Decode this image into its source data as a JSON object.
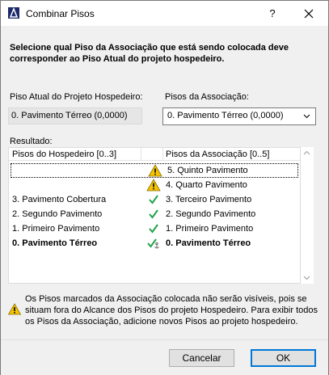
{
  "window": {
    "title": "Combinar Pisos",
    "help_label": "?"
  },
  "instruction": "Selecione qual Piso da Associação que está sendo colocada deve corresponder ao Piso Atual do projeto hospedeiro.",
  "host_current": {
    "label": "Piso Atual do Projeto Hospedeiro:",
    "value": "0. Pavimento Térreo (0,0000)"
  },
  "assoc_floors": {
    "label": "Pisos da Associação:",
    "selected": "0. Pavimento Térreo (0,0000)"
  },
  "result": {
    "label": "Resultado:",
    "columns": {
      "host": "Pisos do Hospedeiro [0..3]",
      "assoc": "Pisos da Associação [0..5]"
    },
    "rows": [
      {
        "host": "",
        "status": "warning",
        "assoc": "5. Quinto Pavimento"
      },
      {
        "host": "",
        "status": "warning",
        "assoc": "4. Quarto Pavimento"
      },
      {
        "host": "3. Pavimento Cobertura",
        "status": "check",
        "assoc": "3. Terceiro Pavimento"
      },
      {
        "host": "2. Segundo Pavimento",
        "status": "check",
        "assoc": "2. Segundo Pavimento"
      },
      {
        "host": "1. Primeiro Pavimento",
        "status": "check",
        "assoc": "1. Primeiro Pavimento"
      },
      {
        "host": "0. Pavimento Térreo",
        "status": "check-anchor",
        "assoc": "0. Pavimento Térreo"
      }
    ]
  },
  "warning_text": "Os Pisos marcados da Associação colocada não serão visíveis, pois se situam fora do Alcance dos Pisos do projeto Hospedeiro. Para exibir todos os Pisos da Associação, adicione novos Pisos ao projeto hospedeiro.",
  "buttons": {
    "cancel": "Cancelar",
    "ok": "OK"
  },
  "colors": {
    "warning": "#f5c400",
    "check": "#1fa34a"
  }
}
